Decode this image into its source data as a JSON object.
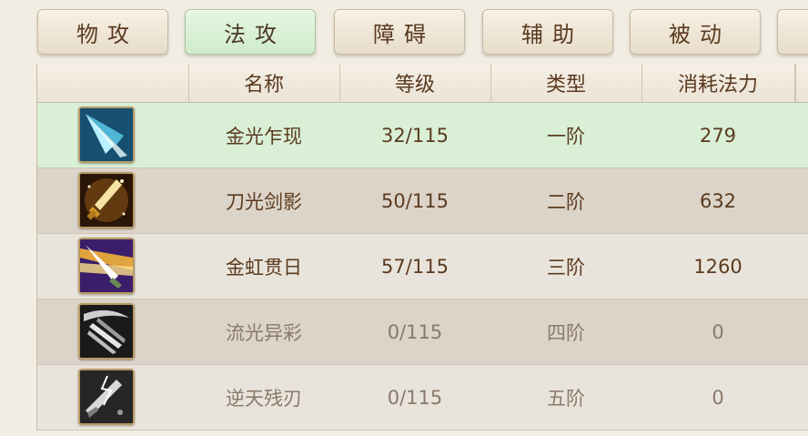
{
  "tabs": [
    {
      "label": "物攻",
      "active": false
    },
    {
      "label": "法攻",
      "active": true
    },
    {
      "label": "障碍",
      "active": false
    },
    {
      "label": "辅助",
      "active": false
    },
    {
      "label": "被动",
      "active": false
    }
  ],
  "table": {
    "headers": {
      "name": "名称",
      "level": "等级",
      "type": "类型",
      "cost": "消耗法力"
    },
    "rows": [
      {
        "icon": "blue-blade-icon",
        "name": "金光乍现",
        "level": "32/115",
        "type": "一阶",
        "cost": "279",
        "selected": true
      },
      {
        "icon": "golden-sword-icon",
        "name": "刀光剑影",
        "level": "50/115",
        "type": "二阶",
        "cost": "632"
      },
      {
        "icon": "radiant-sword-icon",
        "name": "金虹贯日",
        "level": "57/115",
        "type": "三阶",
        "cost": "1260"
      },
      {
        "icon": "gray-trident-icon",
        "name": "流光异彩",
        "level": "0/115",
        "type": "四阶",
        "cost": "0",
        "locked": true
      },
      {
        "icon": "gray-broken-blade-icon",
        "name": "逆天残刃",
        "level": "0/115",
        "type": "五阶",
        "cost": "0",
        "locked": true
      }
    ]
  },
  "colors": {
    "active_tab": "#d9efd6",
    "text": "#5b3b1f",
    "locked_text": "#8a7a6a"
  }
}
